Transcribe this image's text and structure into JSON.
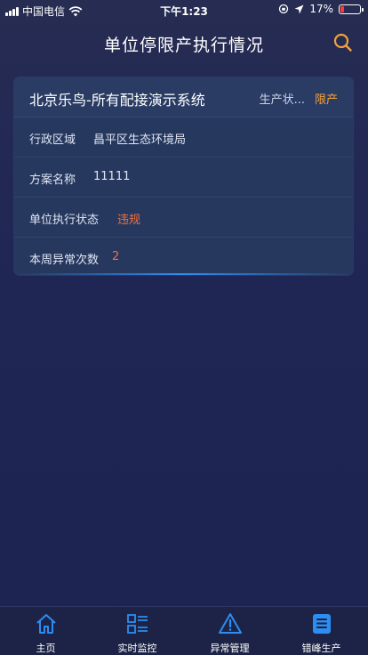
{
  "status_bar": {
    "carrier": "中国电信",
    "time": "下午1:23",
    "battery_percent": "17%",
    "battery_level": 0.17,
    "battery_color": "#ff3b30"
  },
  "header": {
    "title": "单位停限产执行情况",
    "search_icon": "search-icon"
  },
  "card": {
    "name": "北京乐鸟-所有配接演示系统",
    "status_label": "生产状...",
    "status_value": "限产",
    "rows": [
      {
        "label": "行政区域",
        "value": "昌平区生态环境局"
      },
      {
        "label": "方案名称",
        "value": "11111"
      },
      {
        "label": "单位执行状态",
        "value": "违规"
      },
      {
        "label": "本周异常次数",
        "value": "2"
      }
    ]
  },
  "tabbar": {
    "items": [
      {
        "label": "主页",
        "icon": "home-icon"
      },
      {
        "label": "实时监控",
        "icon": "list-grid-icon"
      },
      {
        "label": "异常管理",
        "icon": "warning-icon"
      },
      {
        "label": "错峰生产",
        "icon": "document-icon"
      }
    ]
  },
  "colors": {
    "accent_orange": "#f3a23b",
    "alert_red": "#f2703c",
    "tab_blue": "#2b8ef0"
  }
}
